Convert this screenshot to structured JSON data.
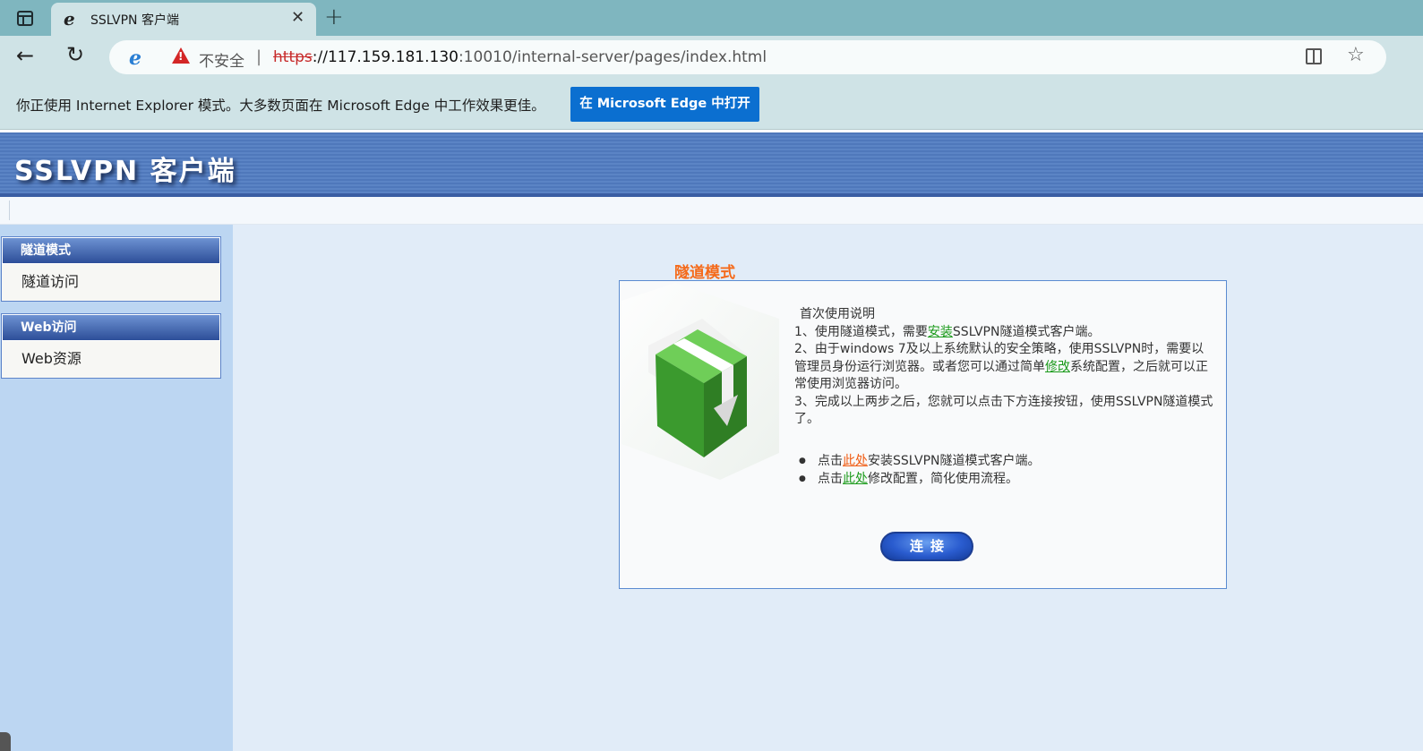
{
  "browser": {
    "tab_title": "SSLVPN 客户端",
    "tab_favicon": "e",
    "new_tab_label": "+",
    "close_label": "✕",
    "security_label": "不安全",
    "url_scheme": "https",
    "url_host": "://117.159.181.130",
    "url_rest": ":10010/internal-server/pages/index.html",
    "ie_mode_message": "你正使用 Internet Explorer 模式。大多数页面在 Microsoft Edge 中工作效果更佳。",
    "ie_mode_button": "在 Microsoft Edge 中打开"
  },
  "header": {
    "title": "SSLVPN 客户端"
  },
  "sidebar": {
    "groups": [
      {
        "title": "隧道模式",
        "items": [
          "隧道访问"
        ]
      },
      {
        "title": "Web访问",
        "items": [
          "Web资源"
        ]
      }
    ]
  },
  "main": {
    "section_title": "隧道模式",
    "heading": "首次使用说明",
    "line1_pre": "1、使用隧道模式，需要",
    "line1_link": "安装",
    "line1_post": "SSLVPN隧道模式客户端。",
    "line2_pre": "2、由于windows 7及以上系统默认的安全策略，使用SSLVPN时，需要以管理员身份运行浏览器。或者您可以通过简单",
    "line2_link": "修改",
    "line2_post": "系统配置，之后就可以正常使用浏览器访问。",
    "line3": "3、完成以上两步之后，您就可以点击下方连接按钮，使用SSLVPN隧道模式了。",
    "bullet1_pre": "点击",
    "bullet1_link": "此处",
    "bullet1_post": "安装SSLVPN隧道模式客户端。",
    "bullet2_pre": "点击",
    "bullet2_link": "此处",
    "bullet2_post": "修改配置，简化使用流程。",
    "connect_button": "连接"
  },
  "colors": {
    "accent_orange": "#f56a1a",
    "link_green": "#1a9a1a",
    "header_blue": "#4f78bb",
    "edge_button": "#0b6fd0"
  }
}
